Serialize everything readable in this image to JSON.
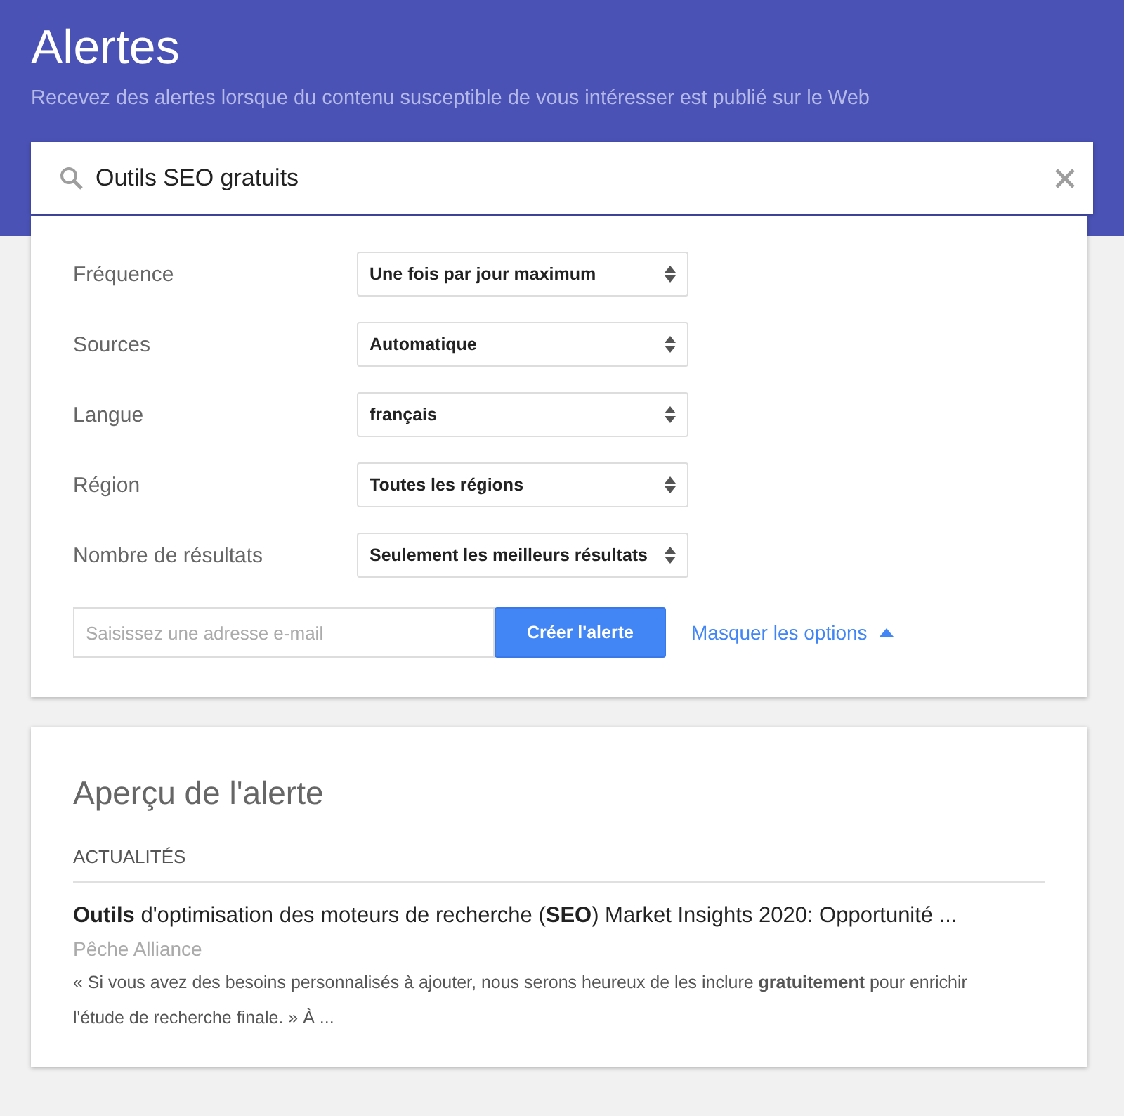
{
  "header": {
    "title": "Alertes",
    "subtitle": "Recevez des alertes lorsque du contenu susceptible de vous intéresser est publié sur le Web"
  },
  "search": {
    "value": "Outils SEO gratuits"
  },
  "options": [
    {
      "label": "Fréquence",
      "value": "Une fois par jour maximum"
    },
    {
      "label": "Sources",
      "value": "Automatique"
    },
    {
      "label": "Langue",
      "value": "français"
    },
    {
      "label": "Région",
      "value": "Toutes les régions"
    },
    {
      "label": "Nombre de résultats",
      "value": "Seulement les meilleurs résultats"
    }
  ],
  "email": {
    "placeholder": "Saisissez une adresse e-mail"
  },
  "create_button": "Créer l'alerte",
  "options_toggle": {
    "label": "Masquer les options",
    "expanded": true
  },
  "preview": {
    "title": "Aperçu de l'alerte",
    "section": "ACTUALITÉS",
    "results": [
      {
        "title": "**Outils** d'optimisation des moteurs de recherche (**SEO**) Market Insights 2020: Opportunité ...",
        "source": "Pêche Alliance",
        "snippet": "« Si vous avez des besoins personnalisés à ajouter, nous serons heureux de les inclure **gratuitement** pour enrichir l'étude de recherche finale. » À ..."
      }
    ]
  }
}
